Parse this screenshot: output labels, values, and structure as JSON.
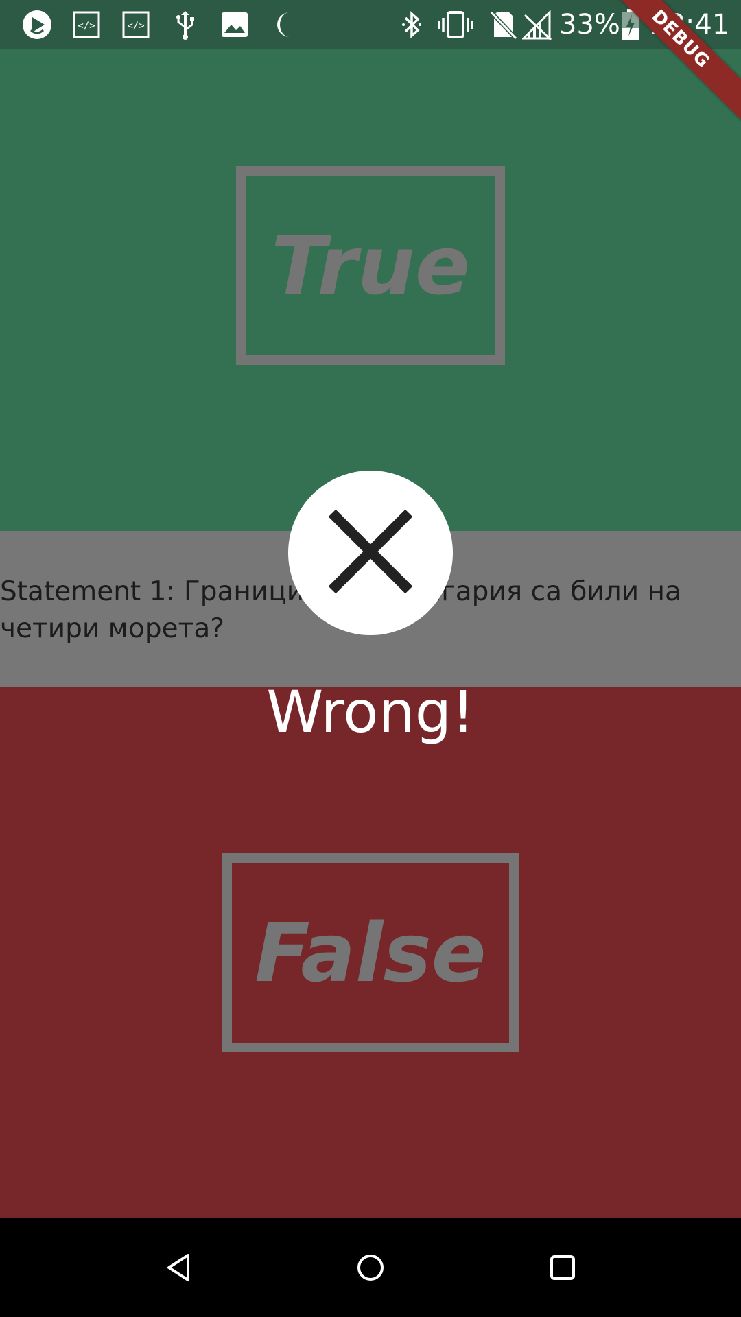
{
  "status_bar": {
    "left_icons": [
      "play-notification-icon",
      "code-icon",
      "code-icon",
      "usb-icon",
      "image-icon",
      "moon-icon"
    ],
    "right_icons": [
      "bluetooth-icon",
      "vibrate-icon",
      "no-sim-icon",
      "no-signal-icon"
    ],
    "battery_percent": "33%",
    "battery_icon": "battery-charging-icon",
    "time": "23:41"
  },
  "debug_banner": "DEBUG",
  "true_button": {
    "label": "True",
    "color": "#347152"
  },
  "false_button": {
    "label": "False",
    "color": "#772729"
  },
  "statement": {
    "text": "Statement 1: Границите на България са били на четири морета?"
  },
  "feedback": {
    "icon": "close-icon",
    "message": "Wrong!"
  },
  "nav_bar": {
    "buttons": [
      "back-icon",
      "home-icon",
      "recents-icon"
    ]
  }
}
